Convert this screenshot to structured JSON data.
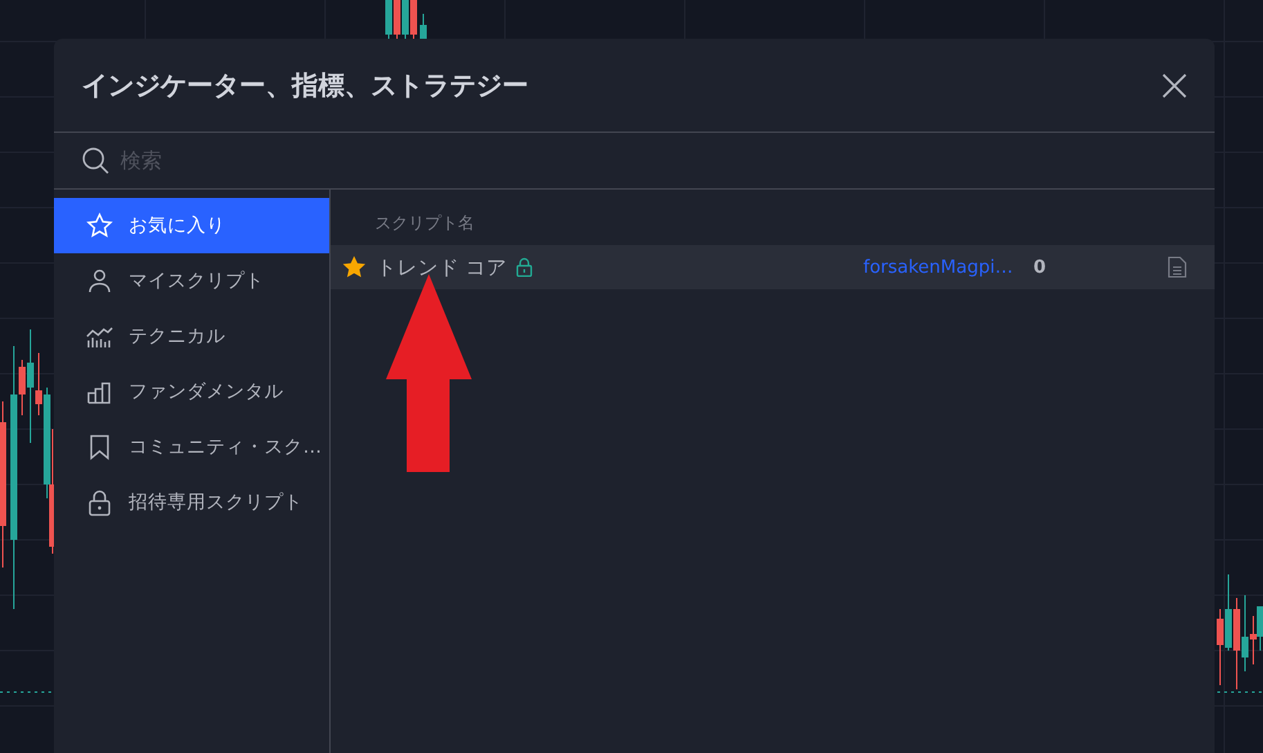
{
  "dialog": {
    "title": "インジケーター、指標、ストラテジー"
  },
  "search": {
    "placeholder": "検索"
  },
  "sidebar": {
    "items": [
      {
        "label": "お気に入り",
        "kind": "star",
        "selected": true
      },
      {
        "label": "マイスクリプト",
        "kind": "person",
        "selected": false
      },
      {
        "label": "テクニカル",
        "kind": "technical",
        "selected": false
      },
      {
        "label": "ファンダメンタル",
        "kind": "bars",
        "selected": false
      },
      {
        "label": "コミュニティ・スク…",
        "kind": "bookmark",
        "selected": false
      },
      {
        "label": "招待専用スクリプト",
        "kind": "lock",
        "selected": false
      }
    ]
  },
  "table": {
    "columns": [
      "スクリプト名"
    ],
    "rows": [
      {
        "name": "トレンド コア",
        "favorite": true,
        "locked": true,
        "author": "forsakenMagpi…",
        "count": "0"
      }
    ]
  }
}
